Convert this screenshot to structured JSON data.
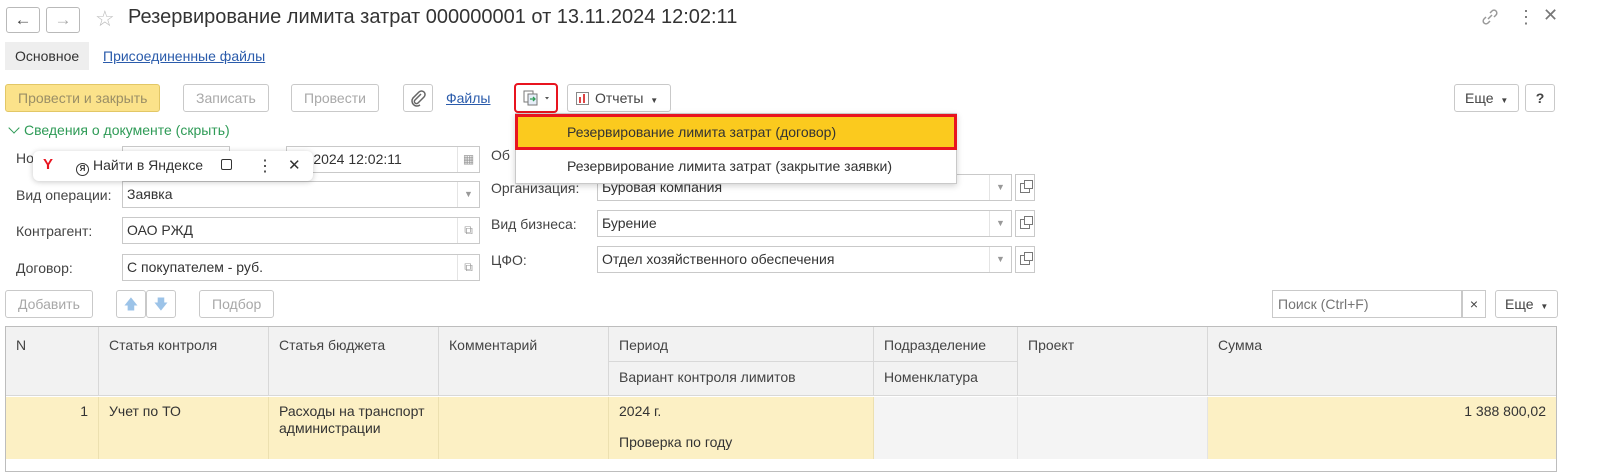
{
  "window": {
    "title": "Резервирование лимита затрат 000000001 от 13.11.2024 12:02:11"
  },
  "tabs": [
    {
      "label": "Основное"
    },
    {
      "label": "Присоединенные файлы"
    }
  ],
  "toolbar": {
    "post_close": "Провести и закрыть",
    "save": "Записать",
    "post": "Провести",
    "files_link": "Файлы",
    "reports": "Отчеты",
    "more": "Еще",
    "help": "?"
  },
  "section": {
    "toggle": "Сведения о документе (скрыть)"
  },
  "form": {
    "number_label_partial": "Но",
    "date_value_partial": ".11.2024 12:02:11",
    "operation_label": "Вид операции:",
    "operation_value": "Заявка",
    "counterparty_label": "Контрагент:",
    "counterparty_value": "ОАО РЖД",
    "contract_label": "Договор:",
    "contract_value": "С покупателем - руб.",
    "general_label_partial": "Об",
    "organization_label": "Организация:",
    "organization_value": "Буровая компания",
    "business_label": "Вид бизнеса:",
    "business_value": "Бурение",
    "cfo_label": "ЦФО:",
    "cfo_value": "Отдел хозяйственного обеспечения"
  },
  "popup": {
    "yandex_letter": "Y",
    "find_label": "Найти в Яндексе",
    "more_glyph": "⋮",
    "close_glyph": "✕"
  },
  "dropdown_menu": {
    "items": [
      {
        "label": "Резервирование лимита затрат (договор)",
        "active": true
      },
      {
        "label": "Резервирование лимита затрат (закрытие заявки)",
        "active": false
      }
    ]
  },
  "table_toolbar": {
    "add": "Добавить",
    "pick": "Подбор",
    "search_placeholder": "Поиск (Ctrl+F)",
    "clear": "×",
    "more": "Еще"
  },
  "table": {
    "headers": {
      "n": "N",
      "control_item": "Статья контроля",
      "budget_item": "Статья бюджета",
      "comment": "Комментарий",
      "period": "Период",
      "limit_variant": "Вариант контроля лимитов",
      "department": "Подразделение",
      "nomenclature": "Номенклатура",
      "project": "Проект",
      "sum": "Сумма"
    },
    "rows": [
      {
        "n": "1",
        "control_item": "Учет по ТО",
        "budget_item": "Расходы на транспорт администрации",
        "comment": "",
        "period": "2024 г.",
        "limit_variant": "Проверка по году",
        "department": "",
        "nomenclature": "",
        "project": "",
        "sum": "1 388 800,02"
      }
    ]
  },
  "colors": {
    "primary_button": "#fbe28a",
    "menu_highlight": "#fbca1e",
    "highlight_border": "#e8141f",
    "row_selected": "#fcf0c4",
    "section_green": "#2f9b57",
    "link_blue": "#2a5bab"
  }
}
